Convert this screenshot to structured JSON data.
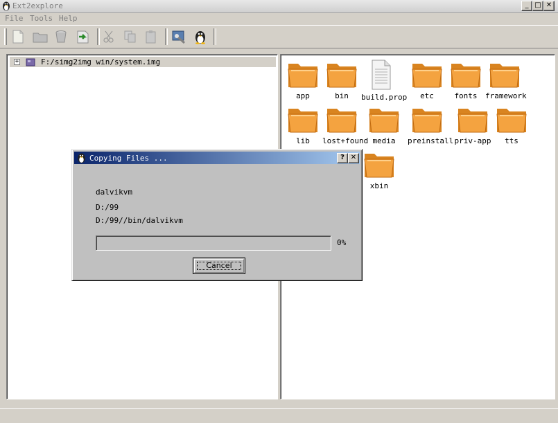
{
  "window": {
    "title": "Ext2explore"
  },
  "menu": [
    {
      "label": "File"
    },
    {
      "label": "Tools"
    },
    {
      "label": "Help"
    }
  ],
  "toolbar": {
    "buttons": [
      "new-file-icon",
      "folder-icon",
      "bucket-icon",
      "export-icon",
      "cut-icon",
      "copy-icon",
      "paste-icon",
      "settings-icon",
      "linux-icon"
    ]
  },
  "tree": {
    "root_label": "F:/simg2img win/system.img"
  },
  "files": [
    {
      "name": "app",
      "type": "folder"
    },
    {
      "name": "bin",
      "type": "folder"
    },
    {
      "name": "build.prop",
      "type": "file"
    },
    {
      "name": "etc",
      "type": "folder"
    },
    {
      "name": "fonts",
      "type": "folder"
    },
    {
      "name": "framework",
      "type": "folder"
    },
    {
      "name": "lib",
      "type": "folder"
    },
    {
      "name": "lost+found",
      "type": "folder"
    },
    {
      "name": "media",
      "type": "folder"
    },
    {
      "name": "preinstall",
      "type": "folder"
    },
    {
      "name": "priv-app",
      "type": "folder"
    },
    {
      "name": "tts",
      "type": "folder"
    },
    {
      "name": "xbin",
      "type": "folder"
    }
  ],
  "dialog": {
    "title": "Copying Files ...",
    "help": "?",
    "close": "✕",
    "file_name": "dalvikvm",
    "destination": "D:/99",
    "target_path": "D:/99//bin/dalvikvm",
    "progress_percent": "0%",
    "progress_value": 0,
    "cancel_label": "Cancel"
  },
  "colors": {
    "dialog_title_start": "#0a246a",
    "dialog_title_end": "#a6caf0",
    "folder": "#f4a340"
  }
}
